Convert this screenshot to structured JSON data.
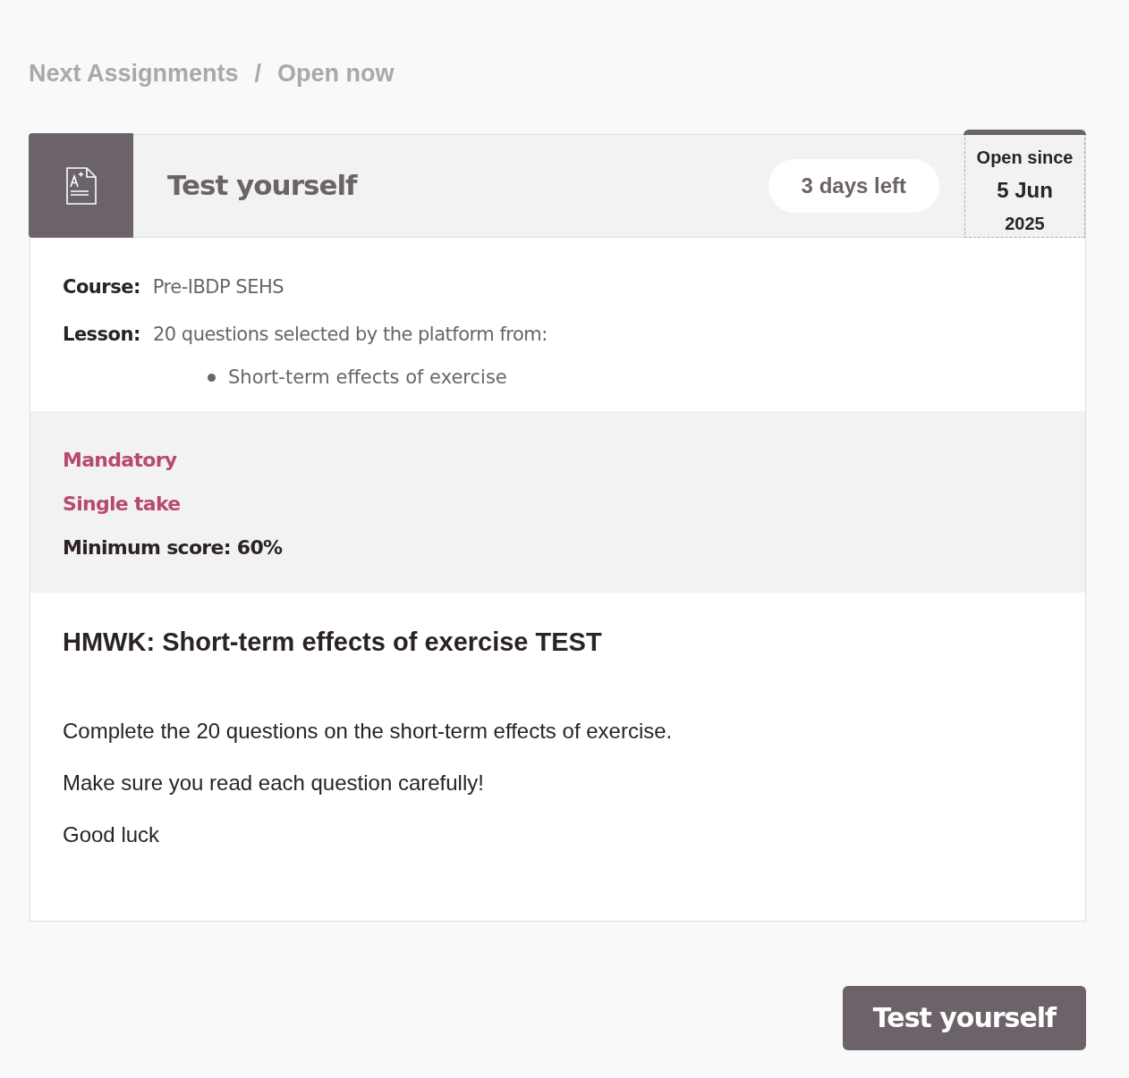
{
  "breadcrumb": {
    "items": [
      "Next Assignments",
      "Open now"
    ],
    "separator": "/"
  },
  "assignment": {
    "title": "Test yourself",
    "time_left": "3 days left",
    "open_since": {
      "label": "Open since",
      "day": "5 Jun",
      "year": "2025"
    },
    "course": {
      "label": "Course:",
      "value": "Pre-IBDP SEHS"
    },
    "lesson": {
      "label": "Lesson:",
      "value": "20 questions selected by the platform from:",
      "topics": [
        "Short-term effects of exercise"
      ]
    },
    "flags": [
      "Mandatory",
      "Single take"
    ],
    "minimum_score": "Minimum score: 60%",
    "heading": "HMWK: Short-term effects of exercise TEST",
    "paragraphs": [
      "Complete the 20 questions on the short-term effects of exercise.",
      "Make sure you read each question carefully!",
      "Good luck"
    ]
  },
  "button": "Test yourself"
}
